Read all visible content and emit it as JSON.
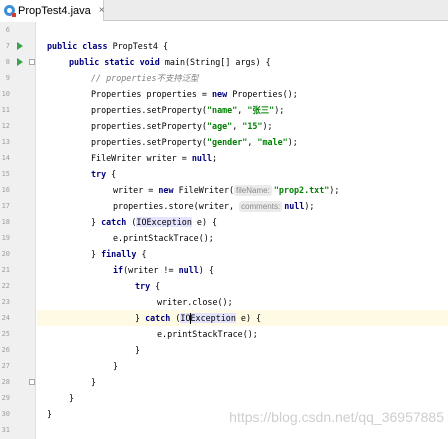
{
  "tab": {
    "title": "PropTest4.java",
    "close": "×"
  },
  "gutter": {
    "line_numbers": [
      "6",
      "7",
      "8",
      "9",
      "10",
      "11",
      "12",
      "13",
      "14",
      "15",
      "16",
      "17",
      "18",
      "19",
      "20",
      "21",
      "22",
      "23",
      "24",
      "25",
      "26",
      "27",
      "28",
      "29",
      "30",
      "31"
    ]
  },
  "code": {
    "l7": {
      "kw1": "public class ",
      "rest": "PropTest4 {"
    },
    "l8": {
      "kw1": "public static void ",
      "rest": "main(String[] args) {"
    },
    "l9": {
      "comment": "// properties不支持泛型"
    },
    "l10": {
      "a": "Properties properties = ",
      "kw": "new ",
      "b": "Properties();"
    },
    "l11": {
      "a": "properties.setProperty(",
      "s1": "\"name\"",
      "b": ", ",
      "s2": "\"张三\"",
      "c": ");"
    },
    "l12": {
      "a": "properties.setProperty(",
      "s1": "\"age\"",
      "b": ", ",
      "s2": "\"15\"",
      "c": ");"
    },
    "l13": {
      "a": "properties.setProperty(",
      "s1": "\"gender\"",
      "b": ", ",
      "s2": "\"male\"",
      "c": ");"
    },
    "l14": {
      "a": "FileWriter writer = ",
      "kw": "null",
      "b": ";"
    },
    "l15": {
      "kw": "try ",
      "b": "{"
    },
    "l16": {
      "a": "writer = ",
      "kw": "new ",
      "b": "FileWriter(",
      "hint": "fileName:",
      "s1": "\"prop2.txt\"",
      "c": ");"
    },
    "l17": {
      "a": "properties.store(writer, ",
      "hint": "comments:",
      "kw": "null",
      "c": ");"
    },
    "l18": {
      "a": "} ",
      "kw": "catch ",
      "b": "(",
      "hl": "IOException",
      "c": " e) {"
    },
    "l19": {
      "a": "e.printStackTrace();"
    },
    "l20": {
      "a": "} ",
      "kw": "finally ",
      "b": "{"
    },
    "l21": {
      "kw": "if",
      "b": "(writer != ",
      "kw2": "null",
      "c": ") {"
    },
    "l22": {
      "kw": "try ",
      "b": "{"
    },
    "l23": {
      "a": "writer.close();"
    },
    "l24": {
      "a": "} ",
      "kw": "catch ",
      "b": "(",
      "hl1": "IO",
      "hl2": "Exception",
      "c": " e) {"
    },
    "l25": {
      "a": "e.printStackTrace();"
    },
    "l26": {
      "a": "}"
    },
    "l27": {
      "a": "}"
    },
    "l28": {
      "a": "}"
    },
    "l29": {
      "a": "}"
    },
    "l30": {
      "a": "}"
    }
  },
  "watermark": "https://blog.csdn.net/qq_36957885",
  "colors": {
    "keyword": "#000080",
    "string": "#008000",
    "comment": "#808080",
    "current_line": "#fffae3",
    "run_arrow": "#3aa24a"
  },
  "icons": [
    "java-class-file-icon",
    "close-tab-icon",
    "run-arrow-icon",
    "fold-marker-icon",
    "text-caret"
  ]
}
